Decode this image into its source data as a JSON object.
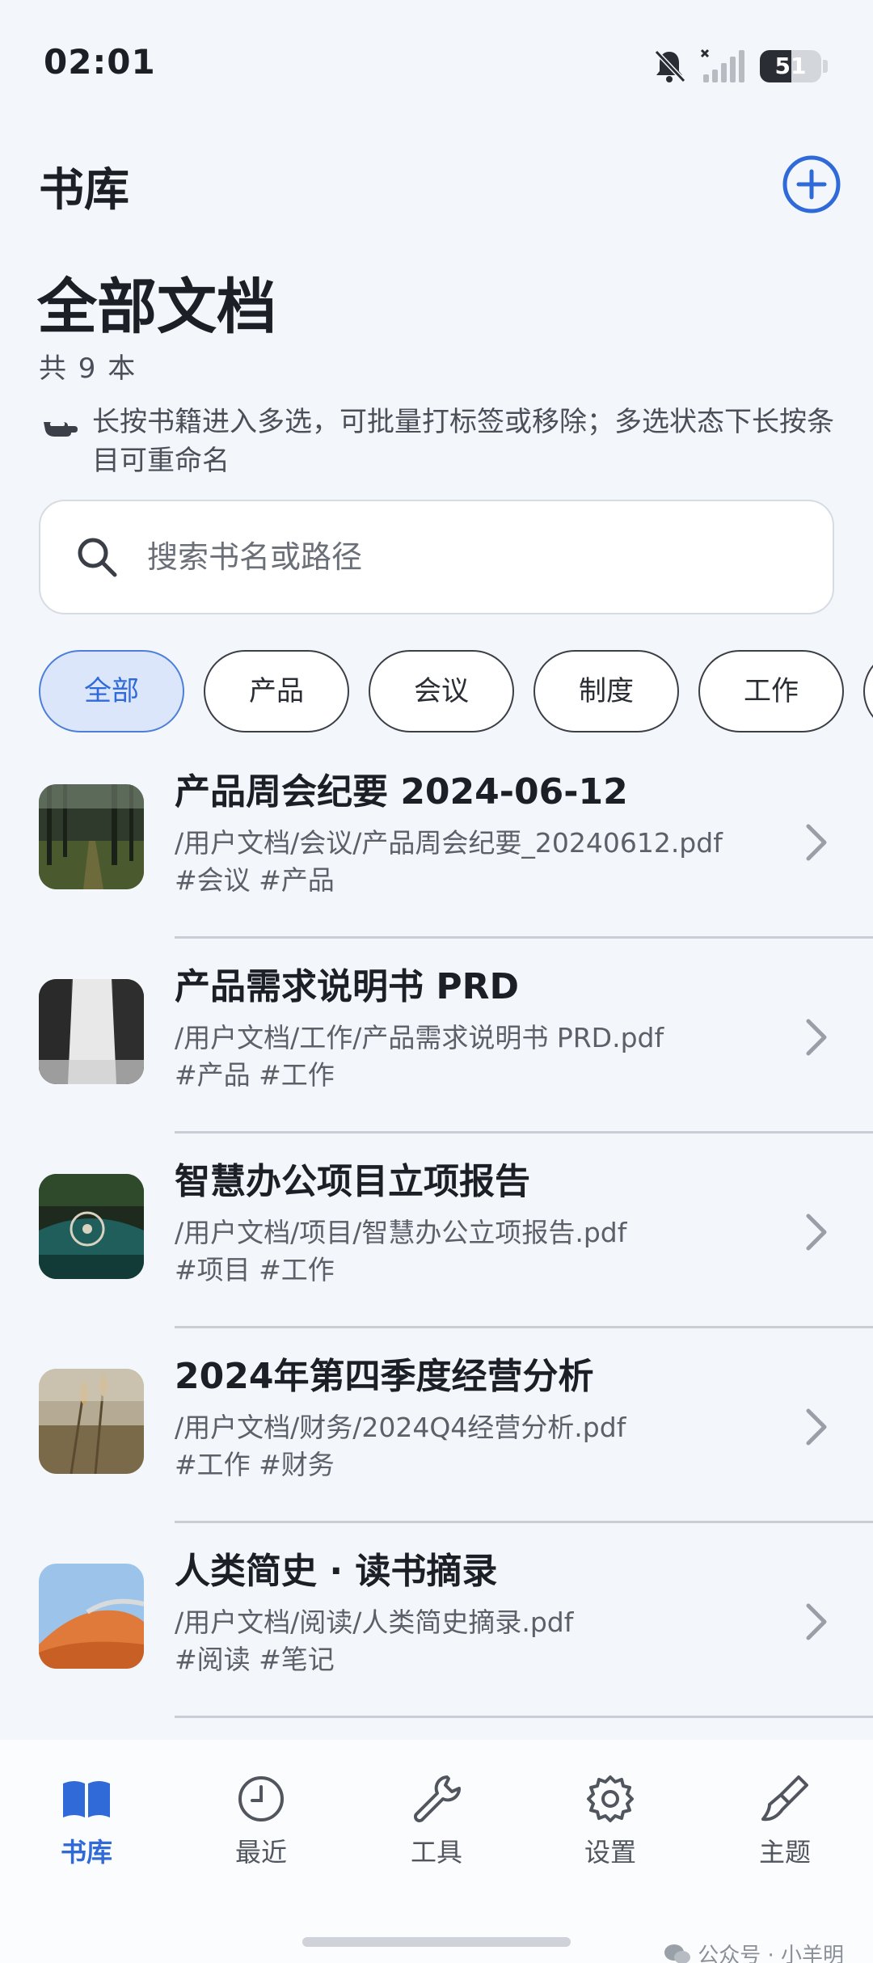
{
  "status_bar": {
    "time": "02:01",
    "battery_level": "51",
    "icons": [
      "bell-muted-icon",
      "signal-off-icon",
      "battery-icon"
    ]
  },
  "header": {
    "app_title": "书库",
    "add_icon": "plus-circle-icon"
  },
  "library": {
    "title": "全部文档",
    "count": "共 9 本",
    "hint": "长按书籍进入多选，可批量打标签或移除；多选状态下长按条目可重命名",
    "hint_icon": "hand-pointer-icon"
  },
  "search": {
    "placeholder": "搜索书名或路径",
    "value": ""
  },
  "filters": {
    "selected": "全部",
    "chips": [
      {
        "label": "全部"
      },
      {
        "label": "产品"
      },
      {
        "label": "会议"
      },
      {
        "label": "制度"
      },
      {
        "label": "工作"
      },
      {
        "label": ""
      }
    ]
  },
  "books": [
    {
      "title": "产品周会纪要 2024-06-12",
      "path": "/用户文档/会议/产品周会纪要_20240612.pdf",
      "tags": "#会议 #产品",
      "thumbnail": "forest-path"
    },
    {
      "title": "产品需求说明书 PRD",
      "path": "/用户文档/工作/产品需求说明书 PRD.pdf",
      "tags": "#产品 #工作",
      "thumbnail": "waterfall"
    },
    {
      "title": "智慧办公项目立项报告",
      "path": "/用户文档/项目/智慧办公立项报告.pdf",
      "tags": "#项目 #工作",
      "thumbnail": "vintage-car"
    },
    {
      "title": "2024年第四季度经营分析",
      "path": "/用户文档/财务/2024Q4经营分析.pdf",
      "tags": "#工作 #财务",
      "thumbnail": "wheat-field"
    },
    {
      "title": "人类简史 · 读书摘录",
      "path": "/用户文档/阅读/人类简史摘录.pdf",
      "tags": "#阅读 #笔记",
      "thumbnail": "desert-dune"
    }
  ],
  "bottom_nav": {
    "active": "书库",
    "items": [
      {
        "label": "书库",
        "icon": "book-open-icon"
      },
      {
        "label": "最近",
        "icon": "clock-icon"
      },
      {
        "label": "工具",
        "icon": "wrench-icon"
      },
      {
        "label": "设置",
        "icon": "gear-icon"
      },
      {
        "label": "主题",
        "icon": "paint-brush-icon"
      }
    ]
  },
  "watermark": "公众号 · 小羊明",
  "colors": {
    "accent": "#2f6ad8",
    "background": "#f3f6fb",
    "chip_active_bg": "#dce6fb"
  }
}
